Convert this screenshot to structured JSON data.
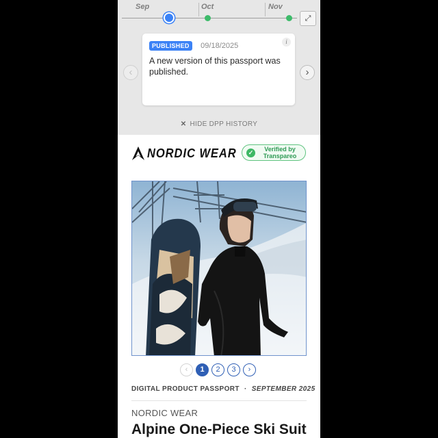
{
  "history": {
    "months": [
      "Sep",
      "Oct",
      "Nov"
    ],
    "card": {
      "badge": "PUBLISHED",
      "date": "09/18/2025",
      "message": "A new version of this passport was published."
    },
    "hide_label": "HIDE DPP HISTORY",
    "accent_color": "#3b82f6",
    "event_color": "#3dbb6a"
  },
  "brand": {
    "name": "NORDIC WEAR",
    "verified_text": "Verified by Transpareo"
  },
  "pager": {
    "prev": "‹",
    "pages": [
      "1",
      "2",
      "3"
    ],
    "active_page": 1,
    "next": "›"
  },
  "meta": {
    "label": "DIGITAL PRODUCT PASSPORT",
    "separator": "·",
    "month": "SEPTEMBER 2025"
  },
  "product": {
    "brand": "NORDIC WEAR",
    "title": "Alpine One-Piece Ski Suit"
  }
}
